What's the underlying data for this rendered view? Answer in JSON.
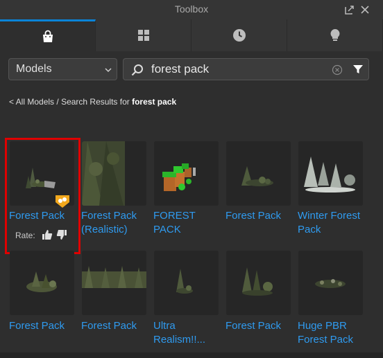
{
  "window": {
    "title": "Toolbox"
  },
  "tabs": [
    {
      "icon": "shopping-bag-icon",
      "active": true
    },
    {
      "icon": "grid-icon",
      "active": false
    },
    {
      "icon": "clock-icon",
      "active": false
    },
    {
      "icon": "lightbulb-icon",
      "active": false
    }
  ],
  "filter": {
    "category_selected": "Models"
  },
  "search": {
    "query": "forest pack"
  },
  "breadcrumb": {
    "link": "< All Models",
    "separator": " / ",
    "prefix": "Search Results for ",
    "term": "forest pack"
  },
  "results": [
    {
      "name": "Forest Pack"
    },
    {
      "name": "Forest Pack (Realistic)"
    },
    {
      "name": "FOREST PACK"
    },
    {
      "name": "Forest Pack"
    },
    {
      "name": "Winter Forest Pack"
    },
    {
      "name": "Forest Pack"
    },
    {
      "name": "Forest Pack"
    },
    {
      "name": "Ultra Realism!!..."
    },
    {
      "name": "Forest Pack"
    },
    {
      "name": "Huge PBR Forest Pack"
    }
  ],
  "hover": {
    "rate_label": "Rate:"
  },
  "colors": {
    "accent": "#0a84d8",
    "link": "#2f9bf0",
    "highlight": "#e00000",
    "badge": "#f2a81d"
  }
}
